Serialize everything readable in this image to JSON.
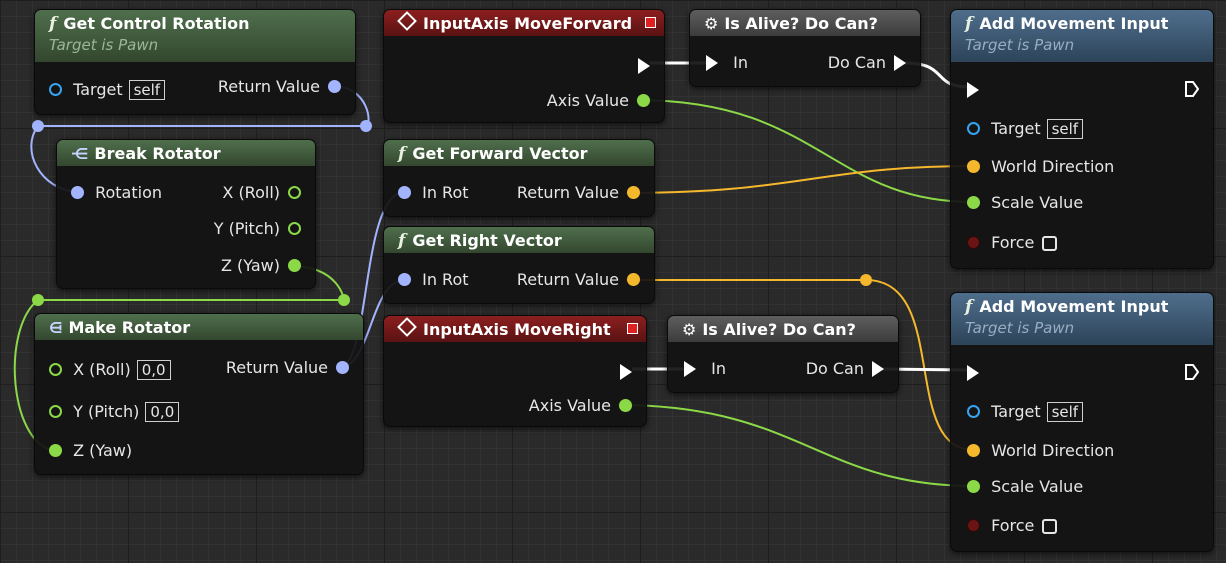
{
  "colors": {
    "wire_exec": "#ffffff",
    "wire_float": "#8cd948",
    "wire_vector": "#f5b82d",
    "wire_rotator": "#a3b4ff",
    "pin_object": "#38a3f0",
    "pin_bool_dark": "#7a1616"
  },
  "nodes": {
    "get_control_rotation": {
      "title": "Get Control Rotation",
      "subtitle": "Target is Pawn",
      "target_label": "Target",
      "target_value": "self",
      "return_label": "Return Value"
    },
    "break_rotator": {
      "title": "Break Rotator",
      "rotation_label": "Rotation",
      "x_label": "X (Roll)",
      "y_label": "Y (Pitch)",
      "z_label": "Z (Yaw)"
    },
    "make_rotator": {
      "title": "Make Rotator",
      "x_label": "X (Roll)",
      "x_value": "0,0",
      "y_label": "Y (Pitch)",
      "y_value": "0,0",
      "z_label": "Z (Yaw)",
      "return_label": "Return Value"
    },
    "input_forward": {
      "title": "InputAxis MoveForvard",
      "axis_label": "Axis Value"
    },
    "get_forward_vector": {
      "title": "Get Forward Vector",
      "in_label": "In Rot",
      "return_label": "Return Value"
    },
    "get_right_vector": {
      "title": "Get Right Vector",
      "in_label": "In Rot",
      "return_label": "Return Value"
    },
    "input_right": {
      "title": "InputAxis MoveRight",
      "axis_label": "Axis Value"
    },
    "alive_1": {
      "title": "Is Alive? Do Can?",
      "in_label": "In",
      "out_label": "Do Can"
    },
    "alive_2": {
      "title": "Is Alive? Do Can?",
      "in_label": "In",
      "out_label": "Do Can"
    },
    "add_movement_1": {
      "title": "Add Movement Input",
      "subtitle": "Target is Pawn",
      "target_label": "Target",
      "target_value": "self",
      "direction_label": "World Direction",
      "scale_label": "Scale Value",
      "force_label": "Force"
    },
    "add_movement_2": {
      "title": "Add Movement Input",
      "subtitle": "Target is Pawn",
      "target_label": "Target",
      "target_value": "self",
      "direction_label": "World Direction",
      "scale_label": "Scale Value",
      "force_label": "Force"
    }
  }
}
